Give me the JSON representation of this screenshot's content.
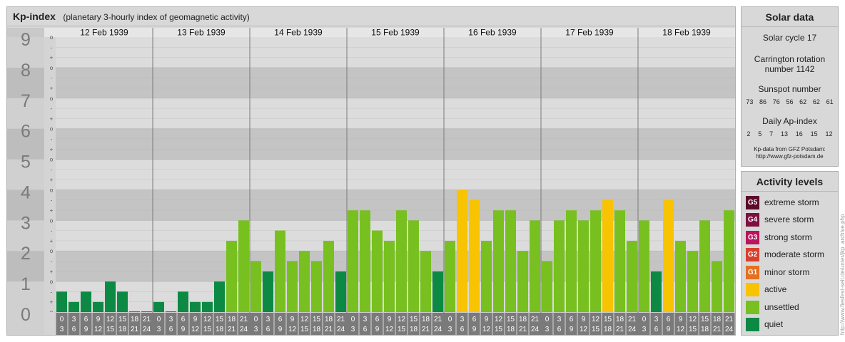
{
  "header": {
    "title": "Kp-index",
    "subtitle": "(planetary 3-hourly index of geomagnetic activity)"
  },
  "chart_data": {
    "type": "bar",
    "title": "Kp-index",
    "subtitle": "(planetary 3-hourly index of geomagnetic activity)",
    "ylim": [
      0,
      9
    ],
    "y_ticks": [
      "0",
      "1",
      "2",
      "3",
      "4",
      "5",
      "6",
      "7",
      "8",
      "9"
    ],
    "y_minor_ticks": [
      "o",
      "+",
      "-"
    ],
    "days": [
      "12 Feb 1939",
      "13 Feb 1939",
      "14 Feb 1939",
      "15 Feb 1939",
      "16 Feb 1939",
      "17 Feb 1939",
      "18 Feb 1939"
    ],
    "interval_start": [
      "0",
      "3",
      "6",
      "9",
      "12",
      "15",
      "18",
      "21"
    ],
    "interval_end": [
      "3",
      "6",
      "9",
      "12",
      "15",
      "18",
      "21",
      "24"
    ],
    "values": [
      [
        0.67,
        0.33,
        0.67,
        0.33,
        1.0,
        0.67,
        0.0,
        0.0
      ],
      [
        0.33,
        0.0,
        0.67,
        0.33,
        0.33,
        1.0,
        2.33,
        3.0
      ],
      [
        1.67,
        1.33,
        2.67,
        1.67,
        2.0,
        1.67,
        2.33,
        1.33
      ],
      [
        3.33,
        3.33,
        2.67,
        2.33,
        3.33,
        3.0,
        2.0,
        1.33
      ],
      [
        2.33,
        4.0,
        3.67,
        2.33,
        3.33,
        3.33,
        2.0,
        3.0
      ],
      [
        1.67,
        3.0,
        3.33,
        3.0,
        3.33,
        3.67,
        3.33,
        2.33
      ],
      [
        3.0,
        1.33,
        3.67,
        2.33,
        2.0,
        3.0,
        1.67,
        3.33
      ]
    ],
    "grid": true,
    "legend": "right"
  },
  "solar": {
    "title": "Solar data",
    "cycle": "Solar cycle 17",
    "carrington_1": "Carrington rotation",
    "carrington_2": "number 1142",
    "sunspot_label": "Sunspot number",
    "sunspot_numbers": [
      "73",
      "86",
      "76",
      "56",
      "62",
      "62",
      "61"
    ],
    "ap_label": "Daily Ap-index",
    "ap_values": [
      "2",
      "5",
      "7",
      "13",
      "16",
      "15",
      "12"
    ],
    "credit_1": "Kp-data from GFZ Potsdam:",
    "credit_2": "http://www.gfz-potsdam.de"
  },
  "activity": {
    "title": "Activity levels",
    "levels": [
      {
        "code": "G5",
        "label": "extreme storm",
        "color": "#5c0a2a"
      },
      {
        "code": "G4",
        "label": "severe storm",
        "color": "#7e1040"
      },
      {
        "code": "G3",
        "label": "strong storm",
        "color": "#b8155c"
      },
      {
        "code": "G2",
        "label": "moderate storm",
        "color": "#d7402e"
      },
      {
        "code": "G1",
        "label": "minor storm",
        "color": "#e47020"
      },
      {
        "code": "",
        "label": "active",
        "color": "#f8c300"
      },
      {
        "code": "",
        "label": "unsettled",
        "color": "#78c020"
      },
      {
        "code": "",
        "label": "quiet",
        "color": "#0c8a44"
      }
    ]
  },
  "colors": {
    "quiet": "#0c8a44",
    "unsettled": "#78c020",
    "active": "#f8c300",
    "band_dark": "#c4c4c4",
    "band_light": "#dcdcdc"
  },
  "credit": "http://www.fiesfest-seit.de/unter/jkp_archive.php"
}
